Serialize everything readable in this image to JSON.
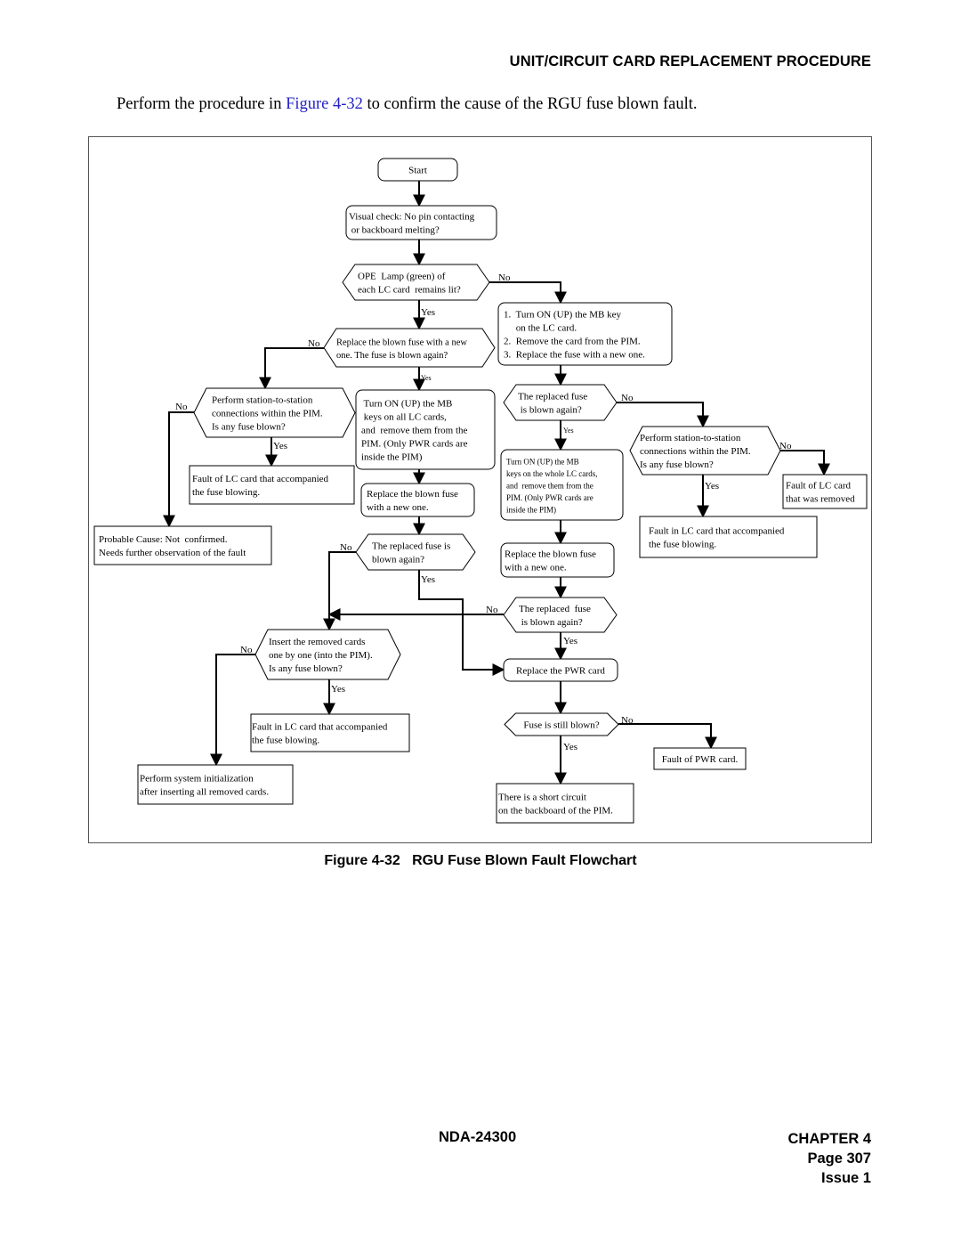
{
  "header": {
    "section_title": "UNIT/CIRCUIT CARD REPLACEMENT PROCEDURE"
  },
  "intro": {
    "before": "Perform the procedure in ",
    "link": "Figure 4-32",
    "after": " to confirm the cause of the RGU fuse blown fault."
  },
  "flowchart": {
    "nodes": {
      "start": [
        "Start"
      ],
      "visual_check": [
        "Visual check: No pin contacting",
        " or backboard melting?"
      ],
      "ope_lamp": [
        "OPE  Lamp (green) of",
        "each LC card  remains lit?"
      ],
      "mb_key_steps": [
        "1.  Turn ON (UP) the MB key",
        "     on the LC card.",
        "2.  Remove the card from the PIM.",
        "3.  Replace the fuse with a new one."
      ],
      "replace_fuse_q": [
        "Replace the blown fuse with a new",
        "one. The fuse is blown again?"
      ],
      "s2s_left": [
        "Perform station-to-station",
        "connections within the PIM.",
        "Is any fuse blown?"
      ],
      "fault_lc_left": [
        "Fault of LC card that accompanied",
        "the fuse blowing."
      ],
      "probable_cause": [
        "Probable Cause: Not  confirmed.",
        "Needs further observation of the fault"
      ],
      "turn_on_all": [
        " Turn ON (UP) the MB",
        " keys on all LC cards,",
        "and  remove them from the",
        "PIM. (Only PWR cards are",
        "inside the PIM)"
      ],
      "replace_blown_mid": [
        "Replace the blown fuse",
        "with a new one."
      ],
      "replaced_again_mid": [
        "The replaced fuse is",
        "blown again?"
      ],
      "replaced_again_right1": [
        "The replaced fuse",
        " is blown again?"
      ],
      "turn_on_whole": [
        "Turn ON (UP) the MB",
        "keys on the whole LC cards,",
        "and  remove them from the",
        "PIM. (Only PWR cards are",
        "inside the PIM)"
      ],
      "s2s_right": [
        "Perform station-to-station",
        "connections within the PIM.",
        "Is any fuse blown?"
      ],
      "fault_lc_removed": [
        "Fault of LC card",
        "that was removed"
      ],
      "fault_lc_right": [
        "Fault in LC card that accompanied",
        "the fuse blowing."
      ],
      "replace_blown_right": [
        "Replace the blown fuse",
        "with a new one."
      ],
      "replaced_again_right2": [
        "The replaced  fuse",
        " is blown again?"
      ],
      "insert_cards": [
        "Insert the removed cards",
        "one by one (into the PIM).",
        "Is any fuse blown?"
      ],
      "replace_pwr": [
        "Replace the PWR card"
      ],
      "fault_lc_bottom": [
        "Fault in LC card that accompanied",
        "the fuse blowing."
      ],
      "system_init": [
        "Perform system initialization",
        "after inserting all removed cards."
      ],
      "fuse_still": [
        "Fuse is still blown?"
      ],
      "short_circuit": [
        "There is a short circuit",
        "on the backboard of the PIM."
      ],
      "fault_pwr": [
        "Fault of PWR card."
      ]
    },
    "labels": {
      "yes": "Yes",
      "no": "No"
    }
  },
  "caption": {
    "prefix": "Figure ",
    "number": "4-32",
    "title": "   RGU Fuse Blown Fault Flowchart"
  },
  "footer": {
    "doc_number": "NDA-24300",
    "chapter": "CHAPTER 4",
    "page": "Page 307",
    "issue": "Issue 1"
  }
}
